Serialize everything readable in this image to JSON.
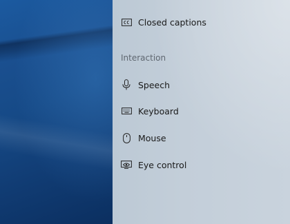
{
  "settings": {
    "vision_items": [
      {
        "label": "Closed captions",
        "icon": "closed-captions-icon"
      }
    ],
    "interaction": {
      "header": "Interaction",
      "items": [
        {
          "label": "Speech",
          "icon": "microphone-icon"
        },
        {
          "label": "Keyboard",
          "icon": "keyboard-icon"
        },
        {
          "label": "Mouse",
          "icon": "mouse-icon"
        },
        {
          "label": "Eye control",
          "icon": "eye-control-icon"
        }
      ]
    }
  },
  "colors": {
    "panel_background": "#c3ced9",
    "wallpaper_blue": "#164a87",
    "text": "#1a1a1a",
    "section_header": "#5f6770"
  }
}
